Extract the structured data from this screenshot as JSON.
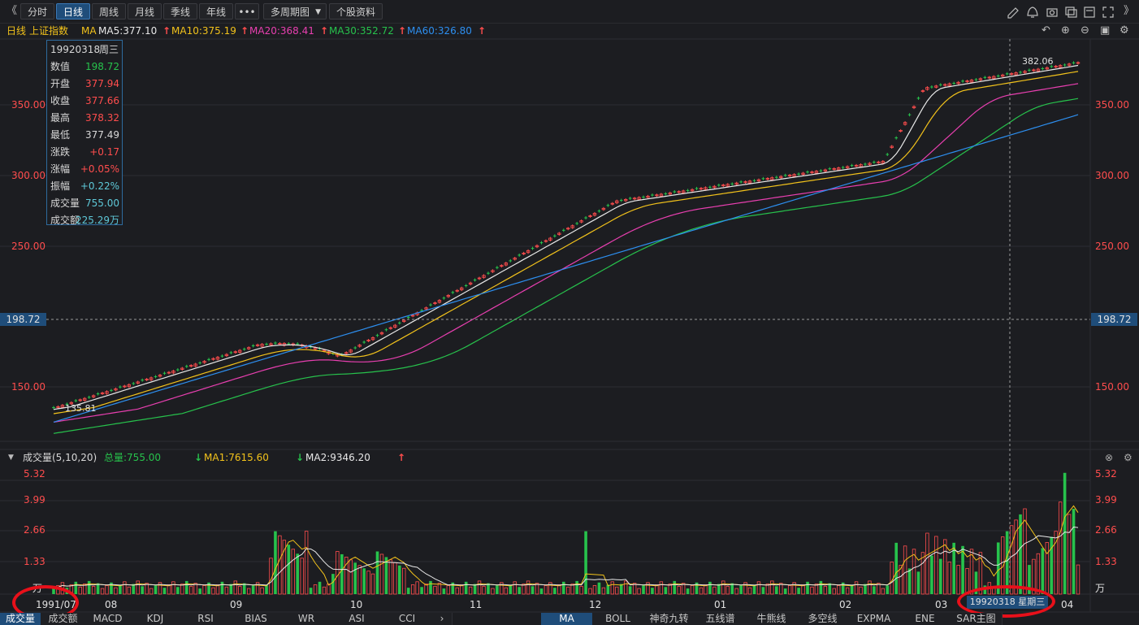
{
  "toolbar": {
    "collapse_icon": "double-chevron-left-icon",
    "tabs": [
      "分时",
      "日线",
      "周线",
      "月线",
      "季线",
      "年线",
      "•••",
      "多周期图",
      "个股资料"
    ],
    "active_tab": "日线",
    "right_icons": [
      "edit-icon",
      "bell-icon",
      "camera-icon",
      "window-icon",
      "settings-window-icon",
      "fullscreen-icon",
      "double-chevron-right-icon"
    ]
  },
  "legend": {
    "period": "日线",
    "name": "上证指数",
    "ma_label": "MA",
    "ma5": "MA5:377.10",
    "ma10": "MA10:375.19",
    "ma20": "MA20:368.41",
    "ma30": "MA30:352.72",
    "ma60": "MA60:326.80"
  },
  "price_axis": {
    "ticks": [
      "350.00",
      "300.00",
      "250.00",
      "150.00"
    ],
    "crosshair_value": "198.72",
    "low_label": "135.81",
    "high_label": "382.06"
  },
  "info": {
    "date": "19920318",
    "weekday": "周三",
    "rows": [
      {
        "k": "数值",
        "v": "198.72",
        "c": "#27c24c"
      },
      {
        "k": "开盘",
        "v": "377.94",
        "c": "#ff4d4d"
      },
      {
        "k": "收盘",
        "v": "377.66",
        "c": "#ff4d4d"
      },
      {
        "k": "最高",
        "v": "378.32",
        "c": "#ff4d4d"
      },
      {
        "k": "最低",
        "v": "377.49",
        "c": "#d8d8d8"
      },
      {
        "k": "涨跌",
        "v": "+0.17",
        "c": "#ff4d4d"
      },
      {
        "k": "涨幅",
        "v": "+0.05%",
        "c": "#ff4d4d"
      },
      {
        "k": "振幅",
        "v": "+0.22%",
        "c": "#5ec8d8"
      },
      {
        "k": "成交量",
        "v": "755.00",
        "c": "#5ec8d8"
      },
      {
        "k": "成交额",
        "v": "225.29万",
        "c": "#5ec8d8"
      }
    ]
  },
  "volume": {
    "title": "成交量(5,10,20)",
    "total": "总量:755.00",
    "ma1": "MA1:7615.60",
    "ma2": "MA2:9346.20",
    "ticks": [
      "5.32",
      "3.99",
      "2.66",
      "1.33"
    ],
    "unit": "万"
  },
  "time_axis": {
    "start_label": "1991/07",
    "months": [
      "08",
      "09",
      "10",
      "11",
      "12",
      "01",
      "02",
      "03",
      "04"
    ],
    "crosshair_date": "19920318 星期三"
  },
  "bottom_tabs_left": [
    "成交量",
    "成交额",
    "MACD",
    "KDJ",
    "RSI",
    "BIAS",
    "WR",
    "ASI",
    "CCI"
  ],
  "bottom_tabs_right": [
    "MA",
    "BOLL",
    "神奇九转",
    "五线谱",
    "牛熊线",
    "多空线",
    "EXPMA",
    "ENE",
    "SAR主图"
  ],
  "colors": {
    "up": "#ff4d4d",
    "down": "#27c24c",
    "ma5": "#e8e8e8",
    "ma10": "#f2c21b",
    "ma20": "#e83fb0",
    "ma30": "#27c24c",
    "ma60": "#2d8ff0",
    "accent": "#1f4d7a"
  }
}
